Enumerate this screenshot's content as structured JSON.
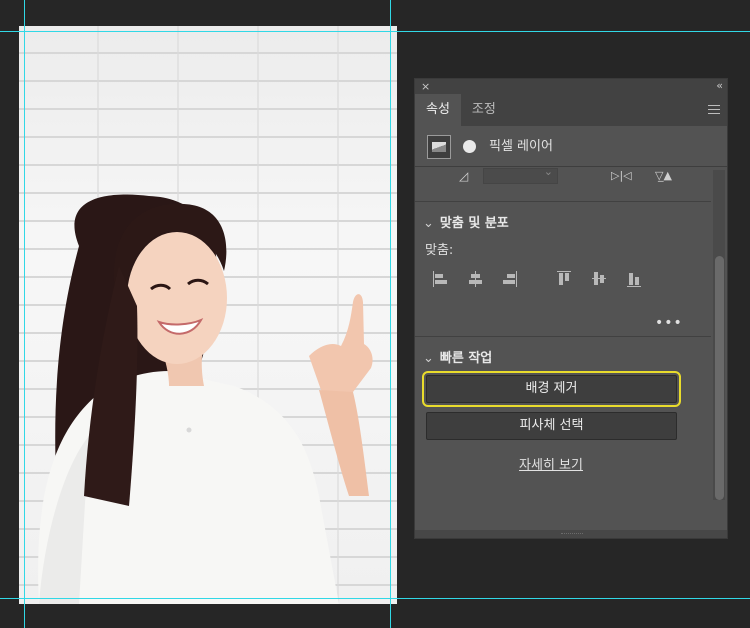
{
  "canvas": {
    "photo_alt": "Photo of a smiling woman in a white t-shirt pointing upward against a white brick wall",
    "guide_color": "#31d8e6"
  },
  "panel": {
    "close_icon": "×",
    "collapse_icon": "‹‹",
    "tabs": [
      {
        "label": "속성",
        "active": true
      },
      {
        "label": "조정",
        "active": false
      }
    ],
    "layer_type": "픽셀 레이어",
    "align_section": {
      "title": "맞춤 및 분포",
      "align_label": "맞춤:",
      "more_label": "•••"
    },
    "quick_actions": {
      "title": "빠른 작업",
      "remove_bg_label": "배경 제거",
      "select_subject_label": "피사체 선택",
      "learn_more_label": "자세히 보기",
      "highlight_color": "#e9dc2c"
    }
  }
}
